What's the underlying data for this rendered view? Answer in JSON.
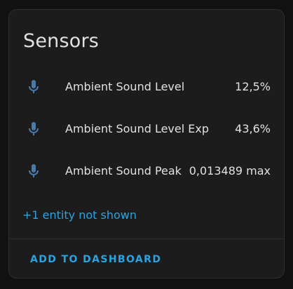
{
  "card": {
    "title": "Sensors",
    "entities": [
      {
        "icon": "microphone-icon",
        "name": "Ambient Sound Level",
        "state": "12,5%"
      },
      {
        "icon": "microphone-icon",
        "name": "Ambient Sound Level Exp",
        "state": "43,6%"
      },
      {
        "icon": "microphone-icon",
        "name": "Ambient Sound Peak",
        "state": "0,013489 max"
      }
    ],
    "more_link": "+1 entity not shown",
    "add_button": "ADD TO DASHBOARD"
  },
  "colors": {
    "background": "#111111",
    "card": "#1c1c1c",
    "text": "#e1e1e1",
    "accent": "#2ba3e0",
    "icon": "#4a7ba8"
  }
}
